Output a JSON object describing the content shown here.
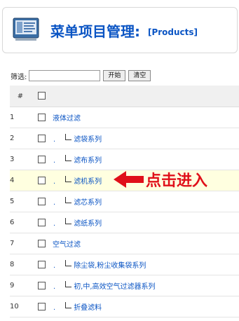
{
  "header": {
    "title": "菜单项目管理",
    "colon": ":",
    "subtitle": "[Products]"
  },
  "filter": {
    "label": "筛选:",
    "value": "",
    "go_label": "开始",
    "reset_label": "清空"
  },
  "table": {
    "col_num": "#",
    "rows": [
      {
        "num": "1",
        "name": "液体过滤",
        "level": 0,
        "dot": ""
      },
      {
        "num": "2",
        "name": "滤袋系列",
        "level": 1,
        "dot": "."
      },
      {
        "num": "3",
        "name": "滤布系列",
        "level": 1,
        "dot": "."
      },
      {
        "num": "4",
        "name": "滤机系列",
        "level": 1,
        "dot": "."
      },
      {
        "num": "5",
        "name": "滤芯系列",
        "level": 1,
        "dot": "."
      },
      {
        "num": "6",
        "name": "滤纸系列",
        "level": 1,
        "dot": "."
      },
      {
        "num": "7",
        "name": "空气过滤",
        "level": 0,
        "dot": ""
      },
      {
        "num": "8",
        "name": "除尘袋,粉尘收集袋系列",
        "level": 1,
        "dot": "."
      },
      {
        "num": "9",
        "name": "初,中,高效空气过滤器系列",
        "level": 1,
        "dot": "."
      },
      {
        "num": "10",
        "name": "折叠滤料",
        "level": 1,
        "dot": "."
      }
    ]
  },
  "annotation": {
    "text": "点击进入",
    "color": "#e0101a"
  },
  "colors": {
    "link": "#0b55c4",
    "highlight_row": "#ffffe0"
  }
}
